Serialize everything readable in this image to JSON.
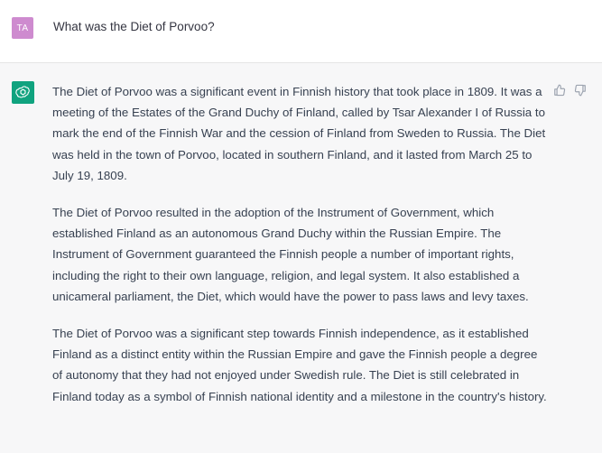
{
  "user": {
    "avatar_initials": "TA",
    "avatar_color": "#ce8bcf",
    "message": "What was the Diet of Porvoo?"
  },
  "assistant": {
    "avatar_icon": "openai-logo-icon",
    "avatar_color": "#10a37f",
    "paragraphs": [
      "The Diet of Porvoo was a significant event in Finnish history that took place in 1809. It was a meeting of the Estates of the Grand Duchy of Finland, called by Tsar Alexander I of Russia to mark the end of the Finnish War and the cession of Finland from Sweden to Russia. The Diet was held in the town of Porvoo, located in southern Finland, and it lasted from March 25 to July 19, 1809.",
      "The Diet of Porvoo resulted in the adoption of the Instrument of Government, which established Finland as an autonomous Grand Duchy within the Russian Empire. The Instrument of Government guaranteed the Finnish people a number of important rights, including the right to their own language, religion, and legal system. It also established a unicameral parliament, the Diet, which would have the power to pass laws and levy taxes.",
      "The Diet of Porvoo was a significant step towards Finnish independence, as it established Finland as a distinct entity within the Russian Empire and gave the Finnish people a degree of autonomy that they had not enjoyed under Swedish rule. The Diet is still celebrated in Finland today as a symbol of Finnish national identity and a milestone in the country's history."
    ],
    "feedback": {
      "thumbs_up_icon": "thumbs-up-icon",
      "thumbs_down_icon": "thumbs-down-icon"
    }
  }
}
